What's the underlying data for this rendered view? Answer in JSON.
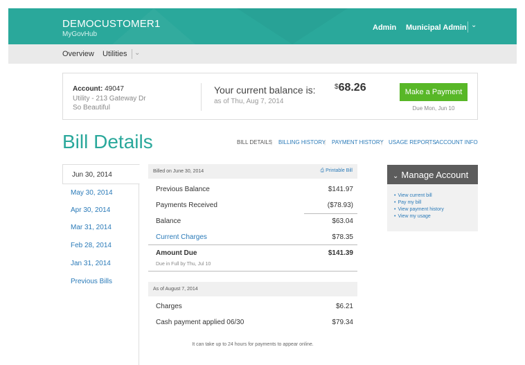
{
  "header": {
    "brand": "DEMOCUSTOMER1",
    "subbrand": "MyGovHub",
    "admin": "Admin",
    "municipal_admin": "Municipal Admin"
  },
  "subnav": {
    "overview": "Overview",
    "utilities": "Utilities"
  },
  "account": {
    "label": "Account:",
    "number": "49047",
    "address_line1": "Utility - 213 Gateway Dr",
    "address_line2": "So Beautiful",
    "balance_label": "Your current balance is:",
    "balance_as_of": "as of Thu, Aug 7, 2014",
    "currency": "$",
    "balance": "68.26",
    "pay_button": "Make a Payment",
    "due": "Due Mon, Jun 10"
  },
  "page": {
    "title": "Bill Details"
  },
  "tabs": [
    {
      "label": "BILL DETAILS"
    },
    {
      "label": "BILLING HISTORY"
    },
    {
      "label": "PAYMENT HISTORY"
    },
    {
      "label": "USAGE REPORTS"
    },
    {
      "label": "ACCOUNT INFO"
    }
  ],
  "dates": {
    "active": "Jun 30, 2014",
    "links": [
      "May 30, 2014",
      "Apr 30, 2014",
      "Mar 31, 2014",
      "Feb 28, 2014",
      "Jan 31, 2014"
    ],
    "previous": "Previous Bills"
  },
  "bill": {
    "billed_on": "Billed on June 30, 2014",
    "printable": "Printable Bill",
    "rows": [
      {
        "label": "Previous Balance",
        "value": "$141.97"
      },
      {
        "label": "Payments Received",
        "value": "($78.93)"
      },
      {
        "label": "Balance",
        "value": "$63.04"
      },
      {
        "label": "Current Charges",
        "value": "$78.35"
      }
    ],
    "amount_due_label": "Amount Due",
    "amount_due_value": "$141.39",
    "amount_due_sub": "Due in Full by Thu, Jul 10",
    "as_of": "As of August 7, 2014",
    "charges_label": "Charges",
    "charges_value": "$6.21",
    "cash_label": "Cash payment applied 06/30",
    "cash_value": "$79.34",
    "note": "It can take up to 24 hours for payments to appear online."
  },
  "manage": {
    "title": "Manage Account",
    "links": [
      "View current bill",
      "Pay my bill",
      "View payment history",
      "View my usage"
    ]
  }
}
